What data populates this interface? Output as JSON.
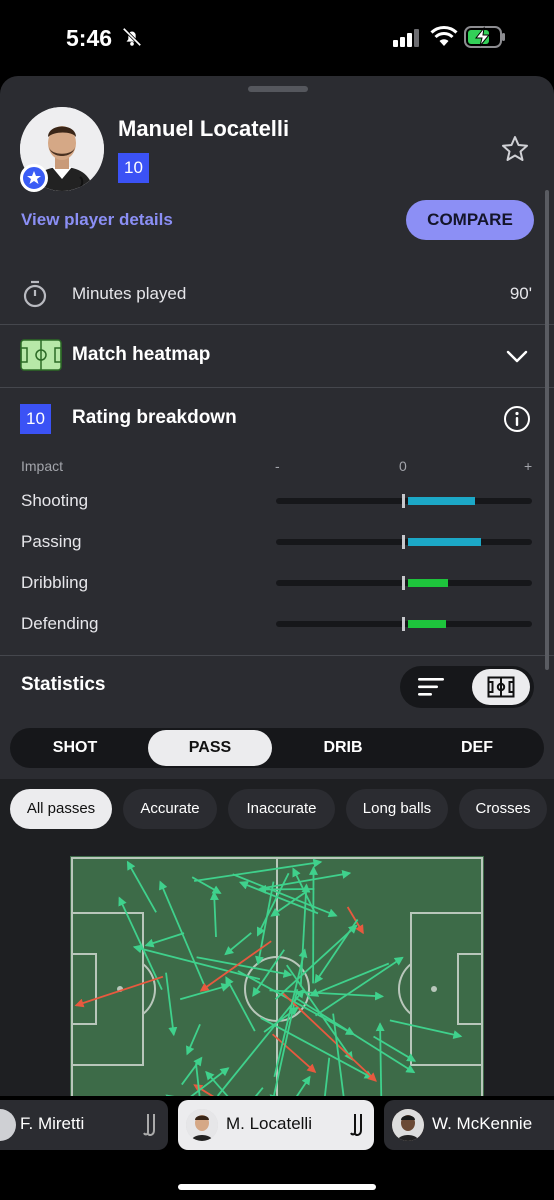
{
  "status_bar": {
    "time": "5:46"
  },
  "player": {
    "name": "Manuel Locatelli",
    "rating": "10",
    "view_details": "View player details",
    "compare": "COMPARE"
  },
  "minutes": {
    "label": "Minutes played",
    "value": "90'"
  },
  "heatmap": {
    "label": "Match heatmap"
  },
  "rating_breakdown": {
    "badge": "10",
    "label": "Rating breakdown",
    "impact_label": "Impact",
    "minus": "-",
    "zero": "0",
    "plus": "+",
    "rows": [
      {
        "label": "Shooting",
        "value": 0.54,
        "color": "#1ca8c7"
      },
      {
        "label": "Passing",
        "value": 0.59,
        "color": "#1ca8c7"
      },
      {
        "label": "Dribbling",
        "value": 0.32,
        "color": "#1ec43c"
      },
      {
        "label": "Defending",
        "value": 0.31,
        "color": "#1ec43c"
      }
    ]
  },
  "statistics": {
    "label": "Statistics",
    "tabs": [
      "SHOT",
      "PASS",
      "DRIB",
      "DEF"
    ],
    "active_tab": "PASS",
    "filters": [
      "All passes",
      "Accurate",
      "Inaccurate",
      "Long balls",
      "Crosses"
    ],
    "active_filter": "All passes"
  },
  "pass_colors": {
    "accurate": "#3fd18c",
    "inaccurate": "#e8593f",
    "pitch": "#3d6b48"
  },
  "player_switcher": [
    {
      "name": "F. Miretti"
    },
    {
      "name": "M. Locatelli"
    },
    {
      "name": "W. McKennie"
    }
  ],
  "icons": [
    "bell-slash-icon",
    "signal-icon",
    "wifi-icon",
    "battery-charging-icon",
    "star-outline-icon",
    "stopwatch-icon",
    "pitch-icon",
    "chevron-down-icon",
    "info-icon",
    "list-icon",
    "club-crest-icon"
  ]
}
